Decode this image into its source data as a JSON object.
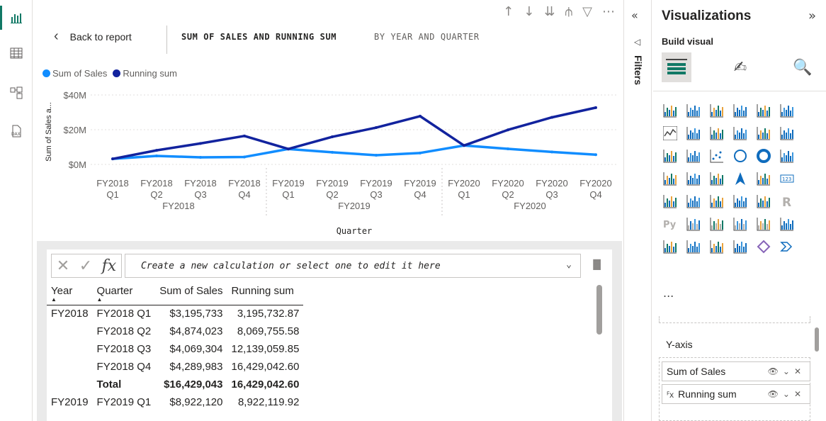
{
  "toolbar": {
    "icons": [
      "sort-up-icon",
      "sort-down-icon",
      "drill-all-icon",
      "expand-hierarchy-icon",
      "filter-icon",
      "more-icon"
    ]
  },
  "focus": {
    "back_label": "Back to report",
    "title": "SUM OF SALES AND RUNNING SUM",
    "subtitle": "BY YEAR AND QUARTER"
  },
  "legend": [
    {
      "label": "Sum of Sales",
      "color": "#118dff"
    },
    {
      "label": "Running sum",
      "color": "#12239e"
    }
  ],
  "chart_data": {
    "type": "line",
    "x": [
      "FY2018 Q1",
      "FY2018 Q2",
      "FY2018 Q3",
      "FY2018 Q4",
      "FY2019 Q1",
      "FY2019 Q2",
      "FY2019 Q3",
      "FY2019 Q4",
      "FY2020 Q1",
      "FY2020 Q2",
      "FY2020 Q3",
      "FY2020 Q4"
    ],
    "x_ticks": [
      [
        "FY2018",
        "Q1"
      ],
      [
        "FY2018",
        "Q2"
      ],
      [
        "FY2018",
        "Q3"
      ],
      [
        "FY2018",
        "Q4"
      ],
      [
        "FY2019",
        "Q1"
      ],
      [
        "FY2019",
        "Q2"
      ],
      [
        "FY2019",
        "Q3"
      ],
      [
        "FY2019",
        "Q4"
      ],
      [
        "FY2020",
        "Q1"
      ],
      [
        "FY2020",
        "Q2"
      ],
      [
        "FY2020",
        "Q3"
      ],
      [
        "FY2020",
        "Q4"
      ]
    ],
    "x_groups": [
      "FY2018",
      "FY2019",
      "FY2020"
    ],
    "series": [
      {
        "name": "Sum of Sales",
        "color": "#118dff",
        "values": [
          3.2,
          4.9,
          4.1,
          4.3,
          8.9,
          7.0,
          5.3,
          6.6,
          10.9,
          9.0,
          7.2,
          5.6
        ]
      },
      {
        "name": "Running sum",
        "color": "#12239e",
        "values": [
          3.2,
          8.1,
          12.1,
          16.4,
          8.9,
          15.9,
          21.2,
          27.8,
          10.9,
          19.9,
          27.1,
          32.7
        ]
      }
    ],
    "ylim": [
      0,
      40
    ],
    "yticks": [
      "$0M",
      "$20M",
      "$40M"
    ],
    "ylabel": "Sum of Sales a...",
    "xlabel": "Quarter",
    "grid": true
  },
  "formula": {
    "placeholder": "Create a new calculation or select one to edit it here",
    "fx": "fx"
  },
  "table": {
    "headers": [
      "Year",
      "Quarter",
      "Sum of Sales",
      "Running sum"
    ],
    "rows": [
      {
        "year": "FY2018",
        "quarter": "FY2018 Q1",
        "sales": "$3,195,733",
        "running": "3,195,732.87",
        "total": false
      },
      {
        "year": "",
        "quarter": "FY2018 Q2",
        "sales": "$4,874,023",
        "running": "8,069,755.58",
        "total": false
      },
      {
        "year": "",
        "quarter": "FY2018 Q3",
        "sales": "$4,069,304",
        "running": "12,139,059.85",
        "total": false
      },
      {
        "year": "",
        "quarter": "FY2018 Q4",
        "sales": "$4,289,983",
        "running": "16,429,042.60",
        "total": false
      },
      {
        "year": "",
        "quarter": "Total",
        "sales": "$16,429,043",
        "running": "16,429,042.60",
        "total": true
      },
      {
        "year": "FY2019",
        "quarter": "FY2019 Q1",
        "sales": "$8,922,120",
        "running": "8,922,119.92",
        "total": false
      }
    ]
  },
  "filters": {
    "label": "Filters"
  },
  "viz": {
    "title": "Visualizations",
    "build_label": "Build visual",
    "more": "...",
    "yaxis_label": "Y-axis",
    "fields": [
      {
        "label": "Sum of Sales"
      },
      {
        "label": "Running sum"
      }
    ]
  }
}
